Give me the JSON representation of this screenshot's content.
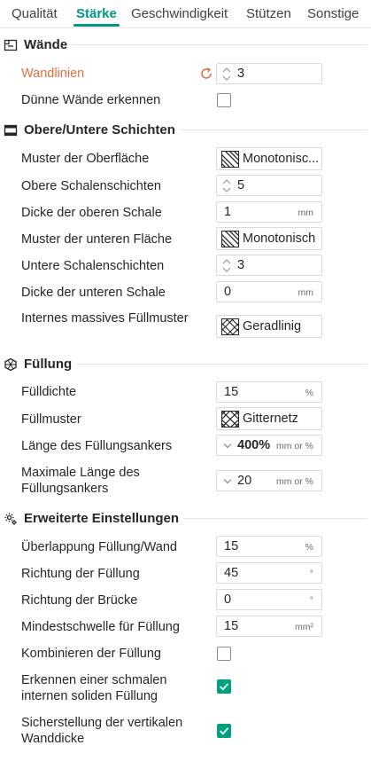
{
  "tabs": [
    "Qualität",
    "Stärke",
    "Geschwindigkeit",
    "Stützen",
    "Sonstige"
  ],
  "colors": {
    "accent": "#009688",
    "modified": "#e0703a",
    "checked": "#00a27e"
  },
  "walls": {
    "title": "Wände",
    "wall_loops": {
      "label": "Wandlinien",
      "value": "3"
    },
    "detect_thin": {
      "label": "Dünne Wände erkennen",
      "checked": false
    }
  },
  "shells": {
    "title": "Obere/Untere Schichten",
    "top_pattern": {
      "label": "Muster der Oberfläche",
      "value": "Monotonisc..."
    },
    "top_layers": {
      "label": "Obere Schalenschichten",
      "value": "5"
    },
    "top_thickness": {
      "label": "Dicke der oberen Schale",
      "value": "1",
      "unit": "mm"
    },
    "bottom_pattern": {
      "label": "Muster der unteren Fläche",
      "value": "Monotonisch"
    },
    "bottom_layers": {
      "label": "Untere Schalenschichten",
      "value": "3"
    },
    "bottom_thickness": {
      "label": "Dicke der unteren Schale",
      "value": "0",
      "unit": "mm"
    },
    "internal_pattern": {
      "label": "Internes massives Füllmuster",
      "value": "Geradlinig"
    }
  },
  "infill": {
    "title": "Füllung",
    "density": {
      "label": "Fülldichte",
      "value": "15",
      "unit": "%"
    },
    "pattern": {
      "label": "Füllmuster",
      "value": "Gitternetz"
    },
    "anchor_length": {
      "label": "Länge des Füllungsankers",
      "value": "400%",
      "unit": "mm or %"
    },
    "anchor_max": {
      "label": "Maximale Länge des Füllungsankers",
      "value": "20",
      "unit": "mm or %"
    }
  },
  "advanced": {
    "title": "Erweiterte Einstellungen",
    "overlap": {
      "label": "Überlappung Füllung/Wand",
      "value": "15",
      "unit": "%"
    },
    "direction": {
      "label": "Richtung der Füllung",
      "value": "45",
      "unit": "°"
    },
    "bridge_direction": {
      "label": "Richtung der Brücke",
      "value": "0",
      "unit": "°"
    },
    "min_area": {
      "label": "Mindestschwelle für Füllung",
      "value": "15",
      "unit": "mm²"
    },
    "combine": {
      "label": "Kombinieren der Füllung",
      "checked": false
    },
    "narrow_solid": {
      "label": "Erkennen einer schmalen internen soliden Füllung",
      "checked": true
    },
    "vertical_thickness": {
      "label": "Sicherstellung der vertikalen Wanddicke",
      "checked": true
    }
  }
}
